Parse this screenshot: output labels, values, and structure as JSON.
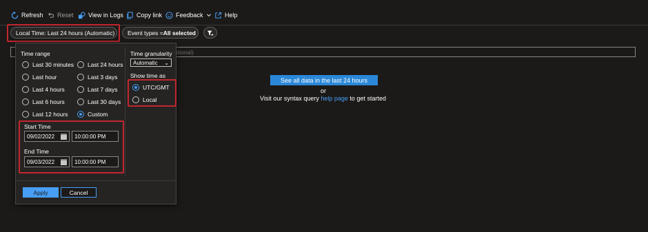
{
  "toolbar": {
    "refresh": "Refresh",
    "reset": "Reset",
    "view_in_logs": "View in Logs",
    "copy_link": "Copy link",
    "feedback": "Feedback",
    "help": "Help"
  },
  "filters": {
    "time_pill": "Local Time: Last 24 hours (Automatic)",
    "event_types_prefix": "Event types = ",
    "event_types_value": "All selected"
  },
  "query": {
    "placeholder_visible": "ptional)"
  },
  "main": {
    "cta": "See all data in the last 24 hours",
    "or": "or",
    "help_prefix": "Visit our syntax query ",
    "help_link": "help page",
    "help_suffix": " to get started"
  },
  "time_range": {
    "title": "Time range",
    "options": [
      {
        "label": "Last 30 minutes",
        "checked": false
      },
      {
        "label": "Last 24 hours",
        "checked": false
      },
      {
        "label": "Last hour",
        "checked": false
      },
      {
        "label": "Last 3 days",
        "checked": false
      },
      {
        "label": "Last 4 hours",
        "checked": false
      },
      {
        "label": "Last 7 days",
        "checked": false
      },
      {
        "label": "Last 6 hours",
        "checked": false
      },
      {
        "label": "Last 30 days",
        "checked": false
      },
      {
        "label": "Last 12 hours",
        "checked": false
      },
      {
        "label": "Custom",
        "checked": true
      }
    ],
    "start_time_label": "Start Time",
    "start_date": "09/02/2022",
    "start_time": "10:00:00 PM",
    "end_time_label": "End Time",
    "end_date": "09/03/2022",
    "end_time": "10:00:00 PM"
  },
  "granularity": {
    "title": "Time granularity",
    "selected": "Automatic"
  },
  "show_time_as": {
    "title": "Show time as",
    "options": [
      {
        "label": "UTC/GMT",
        "checked": true
      },
      {
        "label": "Local",
        "checked": false
      }
    ]
  },
  "actions": {
    "apply": "Apply",
    "cancel": "Cancel"
  },
  "colors": {
    "accent": "#479ef5",
    "highlight_border": "#c4262e",
    "background": "#1b1a19"
  }
}
